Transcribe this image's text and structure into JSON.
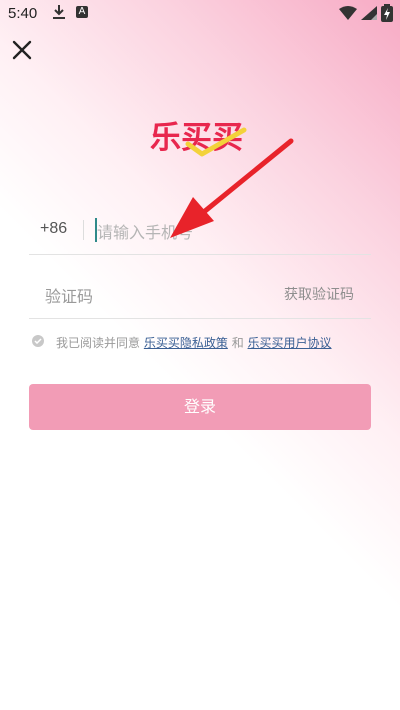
{
  "status_bar": {
    "time": "5:40",
    "badge": "A"
  },
  "logo": {
    "text": "乐买买",
    "color": "#e8274e",
    "check_color": "#f3d23a"
  },
  "phone": {
    "country_code": "+86",
    "placeholder": "请输入手机号"
  },
  "code": {
    "placeholder": "验证码",
    "get_code_label": "获取验证码"
  },
  "agreement": {
    "prefix": "我已阅读并同意",
    "privacy_link": "乐买买隐私政策",
    "and": "和",
    "terms_link": "乐买买用户协议"
  },
  "login_button": {
    "label": "登录",
    "color": "#f29cb6"
  },
  "annotation_arrow": {
    "color": "#e8232a"
  }
}
